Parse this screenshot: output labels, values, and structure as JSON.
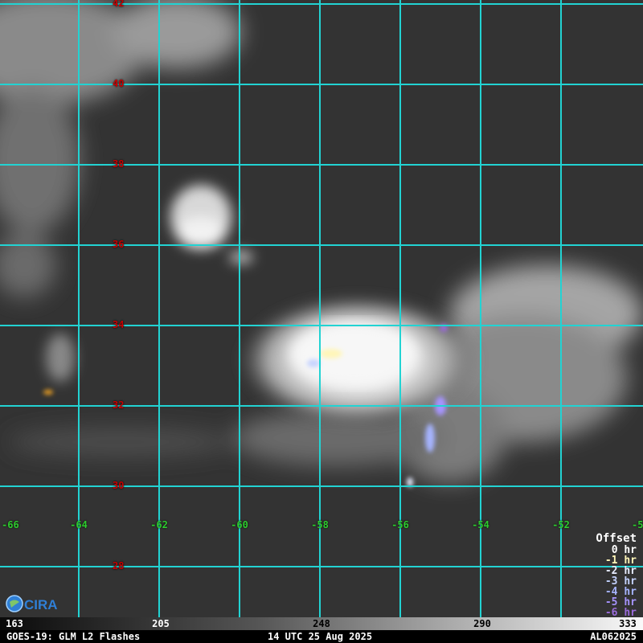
{
  "map": {
    "lat_labels": [
      "42",
      "40",
      "38",
      "36",
      "34",
      "32",
      "30",
      "28"
    ],
    "lon_labels": [
      "-66",
      "-64",
      "-62",
      "-60",
      "-58",
      "-56",
      "-54",
      "-52",
      "-5"
    ]
  },
  "legend": {
    "title": "Offset",
    "items": [
      {
        "label": "0 hr",
        "color": "#ffffff"
      },
      {
        "label": "-1 hr",
        "color": "#fff6b8"
      },
      {
        "label": "-2 hr",
        "color": "#e6ecff"
      },
      {
        "label": "-3 hr",
        "color": "#c4d2ff"
      },
      {
        "label": "-4 hr",
        "color": "#a6b4ff"
      },
      {
        "label": "-5 hr",
        "color": "#a694ff"
      },
      {
        "label": "-6 hr",
        "color": "#9b6cdc"
      }
    ]
  },
  "colorbar": {
    "ticks": [
      "163",
      "205",
      "248",
      "290",
      "333"
    ]
  },
  "footer": {
    "left": "GOES-19: GLM L2 Flashes",
    "center": "14 UTC 25 Aug 2025",
    "right": "AL062025"
  },
  "logo": {
    "text": "CIRA",
    "icon": "cira-logo-icon"
  }
}
